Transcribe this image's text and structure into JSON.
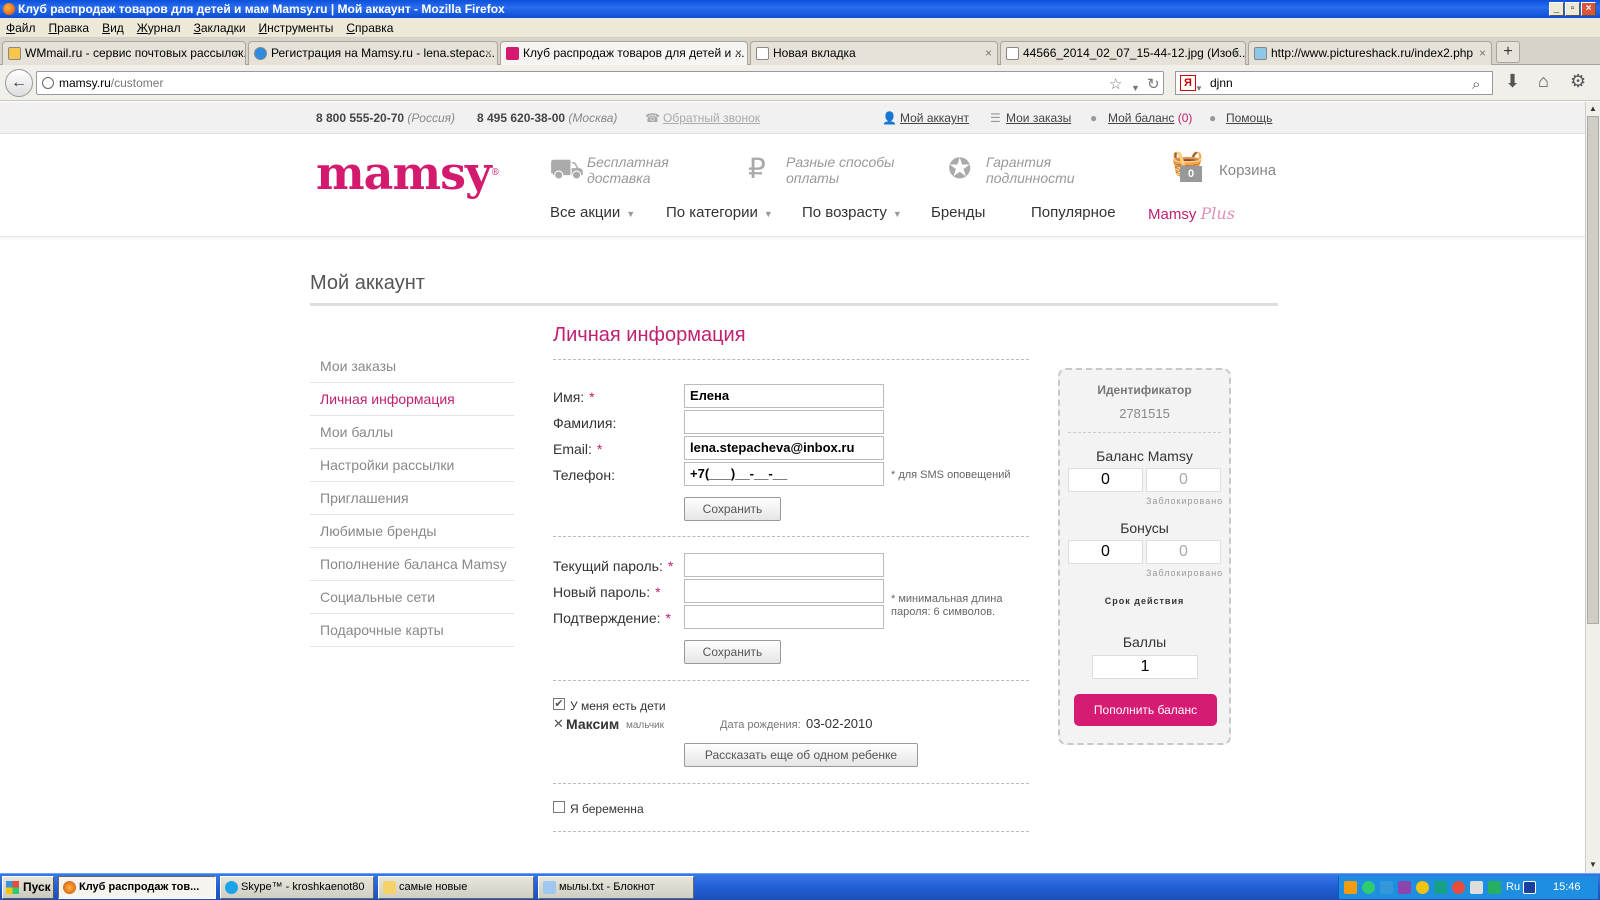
{
  "window": {
    "title": "Клуб распродаж товаров для детей и мам Mamsy.ru | Мой аккаунт - Mozilla Firefox"
  },
  "menubar": [
    "Файл",
    "Правка",
    "Вид",
    "Журнал",
    "Закладки",
    "Инструменты",
    "Справка"
  ],
  "tabs": [
    {
      "label": "WMmail.ru - сервис почтовых рассылок..."
    },
    {
      "label": "Регистрация на Mamsy.ru - lena.stepac..."
    },
    {
      "label": "Клуб распродаж товаров для детей и ..."
    },
    {
      "label": "Новая вкладка"
    },
    {
      "label": "44566_2014_02_07_15-44-12.jpg (Изоб..."
    },
    {
      "label": "http://www.pictureshack.ru/index2.php"
    }
  ],
  "nav": {
    "url_host": "mamsy.ru",
    "url_path": "/customer",
    "search_value": "djnn"
  },
  "topstrip": {
    "phone1": "8 800 555-20-70",
    "phone1_note": "(Россия)",
    "phone2": "8 495 620-38-00",
    "phone2_note": "(Москва)",
    "callback": "Обратный звонок",
    "account": "Мой аккаунт",
    "orders": "Мои заказы",
    "balance": "Мой баланс",
    "balance_count": "(0)",
    "help": "Помощь"
  },
  "header": {
    "logo": "mamsy",
    "feature1": [
      "Бесплатная",
      "доставка"
    ],
    "feature2": [
      "Разные способы",
      "оплаты"
    ],
    "feature3": [
      "Гарантия",
      "подлинности"
    ],
    "cart_label": "Корзина",
    "cart_count": "0",
    "menu": [
      "Все акции",
      "По категории",
      "По возрасту",
      "Бренды",
      "Популярное"
    ],
    "mamsy_plus": "Mamsy",
    "mamsy_plus_script": "Plus"
  },
  "page": {
    "title": "Мой аккаунт"
  },
  "sidebar": {
    "items": [
      {
        "label": "Мои заказы"
      },
      {
        "label": "Личная информация"
      },
      {
        "label": "Мои баллы"
      },
      {
        "label": "Настройки рассылки"
      },
      {
        "label": "Приглашения"
      },
      {
        "label": "Любимые бренды"
      },
      {
        "label": "Пополнение баланса Mamsy"
      },
      {
        "label": "Социальные сети"
      },
      {
        "label": "Подарочные карты"
      }
    ]
  },
  "form": {
    "section_title": "Личная информация",
    "first_name_label": "Имя:",
    "first_name_value": "Елена",
    "last_name_label": "Фамилия:",
    "last_name_value": "",
    "email_label": "Email:",
    "email_value": "lena.stepacheva@inbox.ru",
    "phone_label": "Телефон:",
    "phone_value": "+7(___)__-__-__",
    "phone_hint": "* для SMS оповещений",
    "save_label": "Сохранить",
    "current_pw_label": "Текущий пароль:",
    "new_pw_label": "Новый пароль:",
    "confirm_pw_label": "Подтверждение:",
    "pw_hint": [
      "* минимальная длина",
      "пароля: 6 символов."
    ],
    "save2_label": "Сохранить",
    "has_children_label": "У меня есть дети",
    "child_name": "Максим",
    "child_gender": "мальчик",
    "child_dob_label": "Дата рождения:",
    "child_dob": "03-02-2010",
    "add_child_label": "Рассказать еще об одном ребенке",
    "pregnant_label": "Я беременна"
  },
  "account_box": {
    "id_label": "Идентификатор",
    "id_value": "2781515",
    "balance_label": "Баланс Mamsy",
    "balance_value": "0",
    "balance_locked": "0",
    "locked_label": "Заблокировано",
    "bonus_label": "Бонусы",
    "bonus_value": "0",
    "bonus_locked": "0",
    "locked_label2": "Заблокировано",
    "validity_label": "Срок действия",
    "points_label": "Баллы",
    "points_value": "1",
    "topup_label": "Пополнить баланс"
  },
  "taskbar": {
    "start": "Пуск",
    "items": [
      {
        "label": "Клуб распродаж тов..."
      },
      {
        "label": "Skype™ - kroshkaenot80"
      },
      {
        "label": "самые новые"
      },
      {
        "label": "мылы.txt - Блокнот"
      }
    ],
    "lang": "Ru",
    "clock": "15:46"
  }
}
